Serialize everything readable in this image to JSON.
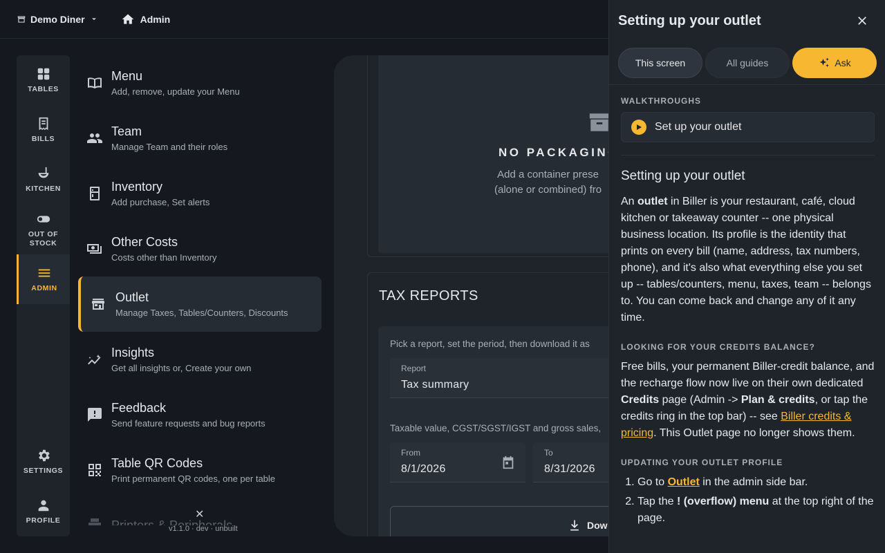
{
  "topbar": {
    "outlet_name": "Demo Diner",
    "home_label": "Admin"
  },
  "rail": {
    "items": [
      {
        "label": "TABLES",
        "icon": "grid-icon"
      },
      {
        "label": "BILLS",
        "icon": "receipt-icon"
      },
      {
        "label": "KITCHEN",
        "icon": "ladle-icon"
      },
      {
        "label": "OUT OF STOCK",
        "icon": "toggle-icon"
      },
      {
        "label": "ADMIN",
        "icon": "menu-icon"
      },
      {
        "label": "SETTINGS",
        "icon": "gear-icon"
      },
      {
        "label": "PROFILE",
        "icon": "person-icon"
      }
    ]
  },
  "menu": {
    "items": [
      {
        "title": "Menu",
        "subtitle": "Add, remove, update your Menu",
        "icon": "book-icon"
      },
      {
        "title": "Team",
        "subtitle": "Manage Team and their roles",
        "icon": "people-icon"
      },
      {
        "title": "Inventory",
        "subtitle": "Add purchase, Set alerts",
        "icon": "fridge-icon"
      },
      {
        "title": "Other Costs",
        "subtitle": "Costs other than Inventory",
        "icon": "money-icon"
      },
      {
        "title": "Outlet",
        "subtitle": "Manage Taxes, Tables/Counters, Discounts",
        "icon": "store-icon"
      },
      {
        "title": "Insights",
        "subtitle": "Get all insights or, Create your own",
        "icon": "insights-icon"
      },
      {
        "title": "Feedback",
        "subtitle": "Send feature requests and bug reports",
        "icon": "feedback-icon"
      },
      {
        "title": "Table QR Codes",
        "subtitle": "Print permanent QR codes, one per table",
        "icon": "qr-icon"
      },
      {
        "title": "Printers & Peripherals",
        "subtitle": "",
        "icon": "printer-icon"
      }
    ],
    "version": "v1.1.0 · dev · unbuilt"
  },
  "content": {
    "packaging": {
      "title": "NO PACKAGING",
      "desc_line1": "Add a container prese",
      "desc_line2": "(alone or combined) fro"
    },
    "tax": {
      "title": "TAX REPORTS",
      "help": "Pick a report, set the period, then download it as",
      "report_label": "Report",
      "report_value": "Tax summary",
      "note": "Taxable value, CGST/SGST/IGST and gross sales,",
      "from_label": "From",
      "from_value": "8/1/2026",
      "to_label": "To",
      "to_value": "8/31/2026",
      "download_label": "Dow"
    }
  },
  "panel": {
    "title": "Setting up your outlet",
    "tabs": {
      "this_screen": "This screen",
      "all_guides": "All guides",
      "ask": "Ask"
    },
    "walkthroughs_head": "WALKTHROUGHS",
    "walkthrough_item": "Set up your outlet",
    "article_title": "Setting up your outlet",
    "p1": {
      "a": "An ",
      "b": "outlet",
      "c": " in Biller is your restaurant, café, cloud kitchen or takeaway counter -- one physical business location. Its profile is the identity that prints on every bill (name, address, tax numbers, phone), and it's also what everything else you set up -- tables/counters, menu, taxes, team -- belongs to. You can come back and change any of it any time."
    },
    "credits_head": "LOOKING FOR YOUR CREDITS BALANCE?",
    "p2": {
      "a": "Free bills, your permanent Biller-credit balance, and the recharge flow now live on their own dedicated ",
      "b": "Credits",
      "c": " page (Admin -> ",
      "d": "Plan & credits",
      "e": ", or tap the credits ring in the top bar) -- see ",
      "link": "Biller credits & pricing",
      "f": ". This Outlet page no longer shows them."
    },
    "update_head": "UPDATING YOUR OUTLET PROFILE",
    "steps": {
      "s1a": "Go to ",
      "s1link": "Outlet",
      "s1b": " in the admin side bar.",
      "s2a": "Tap the ",
      "s2b": "! (overflow) menu",
      "s2c": " at the top right of the page."
    }
  },
  "colors": {
    "accent": "#f7b731",
    "background": "#15191f",
    "surface": "#1f242b"
  }
}
